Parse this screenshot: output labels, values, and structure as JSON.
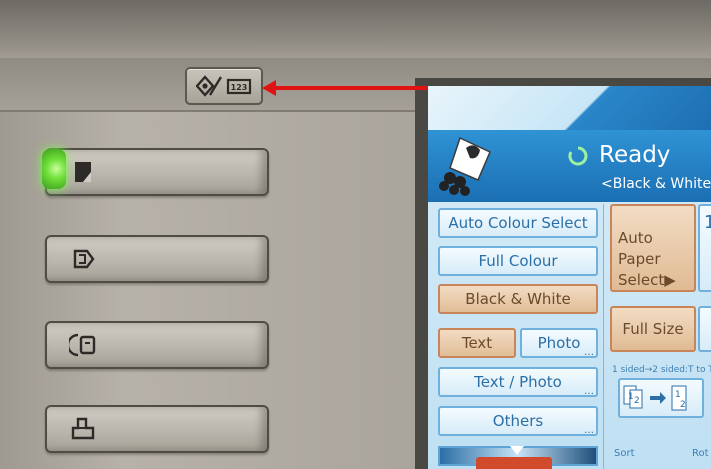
{
  "key_button": {
    "icon_left": "user-tools-counter-icon",
    "icon_right": "counter-123-icon",
    "icon_right_text": "123"
  },
  "annotation": {
    "color": "#e01212"
  },
  "side_buttons": [
    {
      "name": "copy-mode-button",
      "icon": "copy-icon"
    },
    {
      "name": "document-server-button",
      "icon": "document-server-icon"
    },
    {
      "name": "fax-mode-button",
      "icon": "fax-icon"
    },
    {
      "name": "printer-mode-button",
      "icon": "printer-icon"
    }
  ],
  "screen": {
    "status": "Ready",
    "mode": "<Black & White",
    "color_options": [
      "Auto Colour Select",
      "Full Colour",
      "Black & White"
    ],
    "text": "Text",
    "photo": "Photo",
    "text_photo": "Text / Photo",
    "others": "Others",
    "auto_paper": "Auto Paper",
    "auto_paper_select": "Select▶",
    "paper_right_partial": "1",
    "full_size": "Full Size",
    "duplex_label": "1 sided→2 sided:T to T",
    "duplex_a": "1",
    "duplex_b": "2",
    "duplex_c": "1",
    "duplex_d": "2",
    "sort": "Sort",
    "rotate": "Rot",
    "colors": {
      "header": "#1b6fb3",
      "selected": "#e0bd97",
      "option_text": "#2b6fa6"
    }
  }
}
